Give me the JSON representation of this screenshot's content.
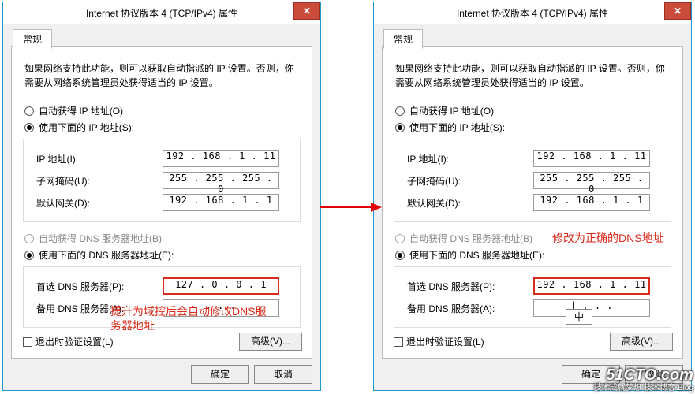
{
  "window_title": "Internet 协议版本 4 (TCP/IPv4) 属性",
  "close_glyph": "✕",
  "tab": {
    "label": "常规"
  },
  "description": "如果网络支持此功能，则可以获取自动指派的 IP 设置。否则，你需要从网络系统管理员处获得适当的 IP 设置。",
  "radio_ip_auto": "自动获得 IP 地址(O)",
  "radio_ip_manual": "使用下面的 IP 地址(S):",
  "field_ip": "IP 地址(I):",
  "field_mask": "子网掩码(U):",
  "field_gw": "默认网关(D):",
  "radio_dns_auto": "自动获得 DNS 服务器地址(B)",
  "radio_dns_manual": "使用下面的 DNS 服务器地址(E):",
  "field_dns1": "首选 DNS 服务器(P):",
  "field_dns2": "备用 DNS 服务器(A):",
  "check_exit_validate": "退出时验证设置(L)",
  "btn_advanced": "高级(V)...",
  "btn_ok": "确定",
  "btn_cancel": "取消",
  "left": {
    "ip": "192 . 168 .  1  . 11",
    "mask": "255 . 255 . 255 .  0",
    "gw": "192 . 168 .  1  .  1",
    "dns1": "127 .  0  .  0  .  1",
    "dns2": "  .     .     .  "
  },
  "right": {
    "ip": "192 . 168 .  1  . 11",
    "mask": "255 . 255 . 255 .  0",
    "gw": "192 . 168 .  1  .  1",
    "dns1": "192 . 168 .  1  . 11",
    "dns2": "|  .     .     .  "
  },
  "annotation_left": "提升为域控后会自动修改DNS服务器地址",
  "annotation_right": "修改为正确的DNS地址",
  "ime_text": "中",
  "watermark": {
    "big": "51CTO.com",
    "small": "技术成就梦想·技术博客 Blog"
  }
}
